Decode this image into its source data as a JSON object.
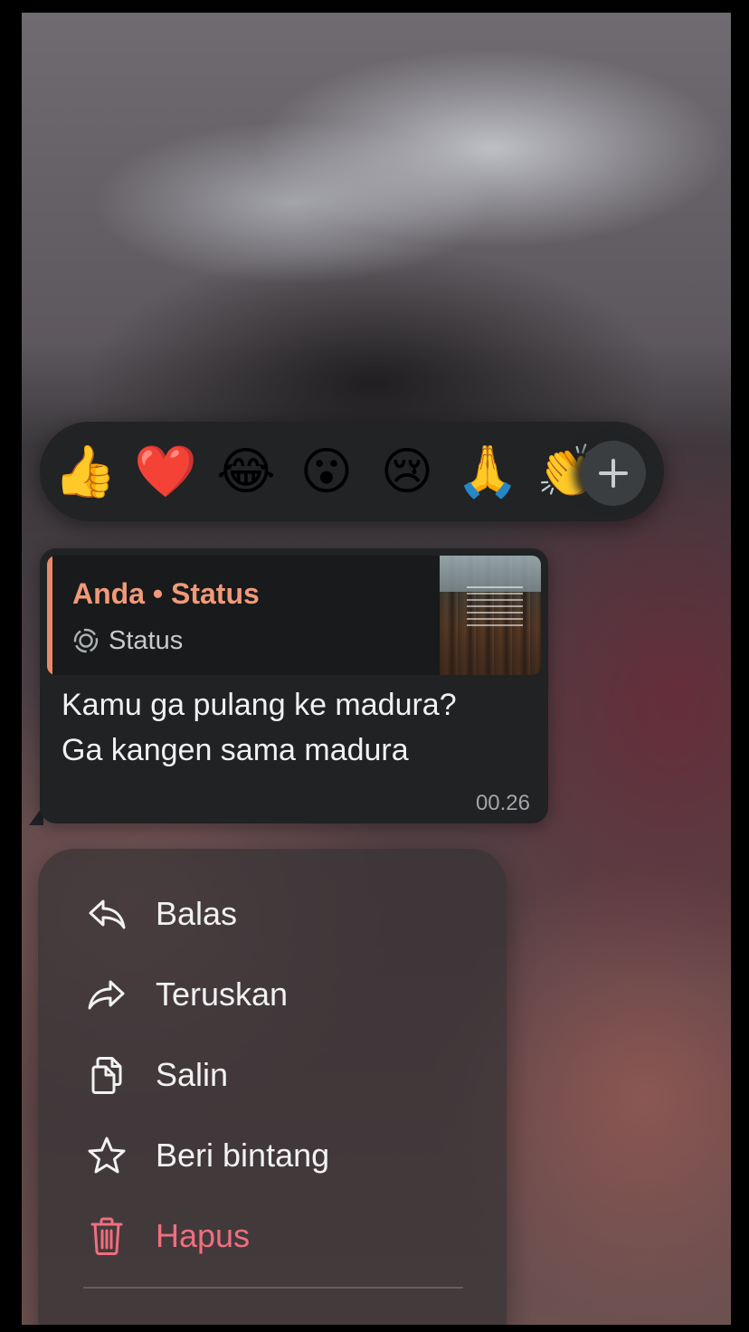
{
  "reactions": {
    "items": [
      {
        "emoji": "👍",
        "name": "thumbs-up"
      },
      {
        "emoji": "❤️",
        "name": "red-heart"
      },
      {
        "emoji": "😂",
        "name": "tears-of-joy"
      },
      {
        "emoji": "😮",
        "name": "surprised"
      },
      {
        "emoji": "😢",
        "name": "crying"
      },
      {
        "emoji": "🙏",
        "name": "folded-hands"
      },
      {
        "emoji": "👏",
        "name": "clapping-hands"
      }
    ],
    "more_icon": "plus-icon"
  },
  "message": {
    "quote": {
      "author": "Anda • Status",
      "subtitle": "Status",
      "subtitle_icon": "status-icon",
      "accent_color": "#e8896a"
    },
    "text_lines": [
      "Kamu ga pulang ke madura?",
      "Ga kangen sama madura"
    ],
    "time": "00.26"
  },
  "menu": {
    "items": [
      {
        "label": "Balas",
        "icon": "reply-icon"
      },
      {
        "label": "Teruskan",
        "icon": "forward-icon"
      },
      {
        "label": "Salin",
        "icon": "copy-icon"
      },
      {
        "label": "Beri bintang",
        "icon": "star-icon"
      },
      {
        "label": "Hapus",
        "icon": "trash-icon",
        "color": "#ef6f7f"
      }
    ]
  }
}
